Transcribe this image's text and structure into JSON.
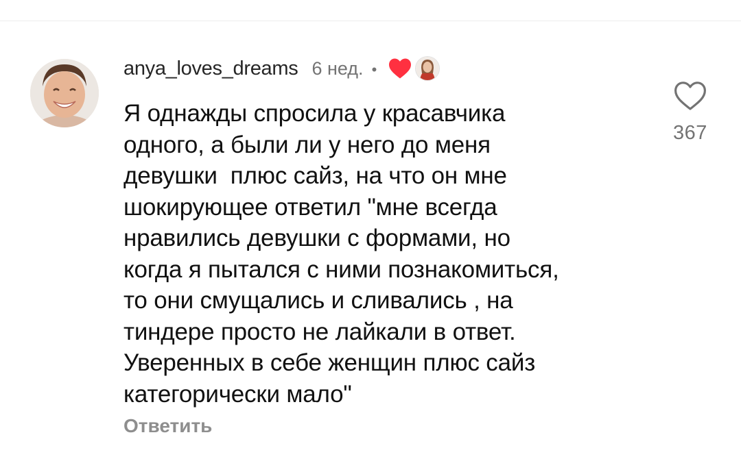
{
  "comment": {
    "username": "anya_loves_dreams",
    "time": "6 нед.",
    "separator": "•",
    "text_lines": [
      "Я однажды спросила у красавчика",
      "одного, а были ли у него до меня",
      "девушки  плюс сайз, на что он мне",
      "шокирующее ответил \"мне всегда",
      "нравились девушки с формами, но",
      "когда я пытался с ними познакомиться,",
      "то они смущались и сливались , на",
      "тиндере просто не лайкали в ответ.",
      "Уверенных в себе женщин плюс сайз",
      "категорически мало\""
    ],
    "reply_label": "Ответить",
    "like_count": "367",
    "icons": {
      "creator_liked": "filled-heart-icon",
      "like": "heart-outline-icon"
    },
    "colors": {
      "heart_red": "#ff3040",
      "muted": "#737373",
      "reply": "#8e8e8e"
    }
  }
}
